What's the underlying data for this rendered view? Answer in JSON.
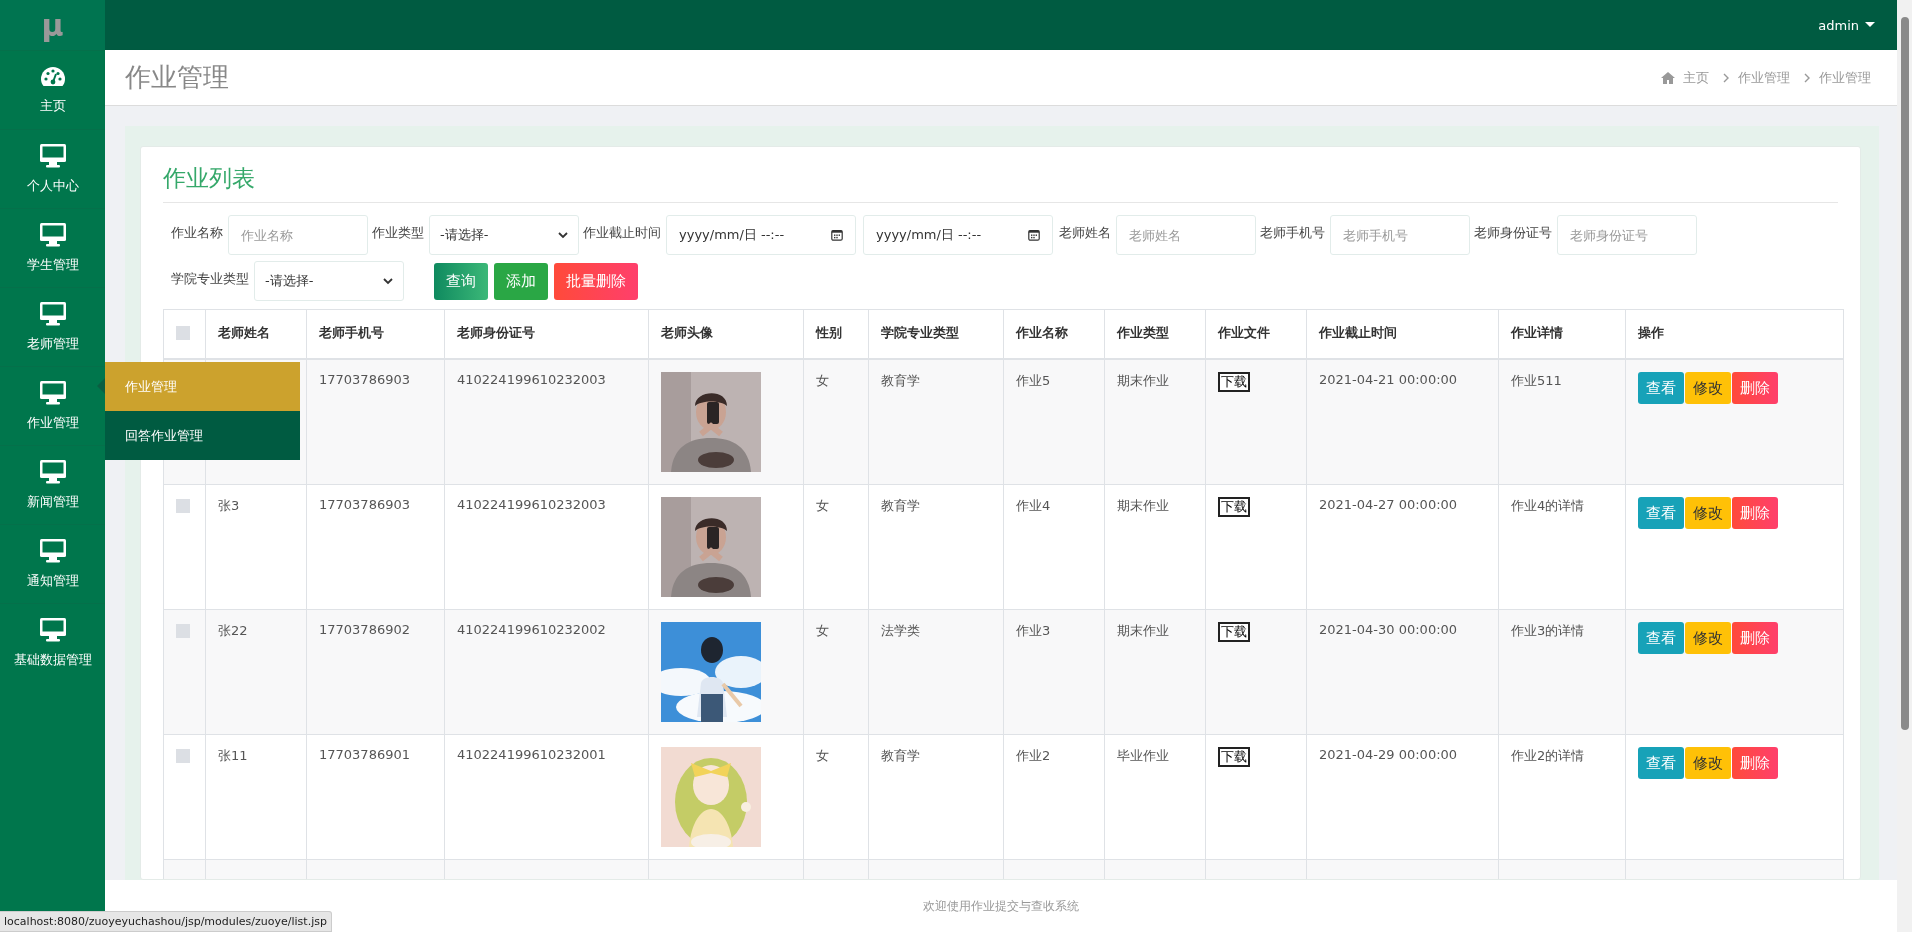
{
  "logo": "μ",
  "user_menu": {
    "label": "admin"
  },
  "sidebar": {
    "items": [
      {
        "label": "主页"
      },
      {
        "label": "个人中心"
      },
      {
        "label": "学生管理"
      },
      {
        "label": "老师管理"
      },
      {
        "label": "作业管理"
      },
      {
        "label": "新闻管理"
      },
      {
        "label": "通知管理"
      },
      {
        "label": "基础数据管理"
      }
    ]
  },
  "submenu": {
    "items": [
      {
        "label": "作业管理",
        "selected": true
      },
      {
        "label": "回答作业管理",
        "selected": false
      }
    ]
  },
  "page_title": "作业管理",
  "breadcrumb": [
    "主页",
    "作业管理",
    "作业管理"
  ],
  "card_title": "作业列表",
  "filter_rows": [
    [
      {
        "kind": "text",
        "label": "作业名称",
        "placeholder": "作业名称"
      },
      {
        "kind": "select",
        "label": "作业类型",
        "value": "-请选择-"
      },
      {
        "kind": "date_range",
        "label": "作业截止时间",
        "fields": [
          {
            "placeholder": "yyyy/mm/日 --:--"
          },
          {
            "placeholder": "yyyy/mm/日 --:--"
          }
        ]
      },
      {
        "kind": "text",
        "label": "老师姓名",
        "placeholder": "老师姓名"
      },
      {
        "kind": "text",
        "label": "老师手机号",
        "placeholder": "老师手机号"
      },
      {
        "kind": "text",
        "label": "老师身份证号",
        "placeholder": "老师身份证号"
      }
    ],
    [
      {
        "kind": "select",
        "label": "学院专业类型",
        "value": "-请选择-"
      },
      {
        "kind": "buttons",
        "buttons": [
          {
            "kind": "query",
            "label": "查询"
          },
          {
            "kind": "add",
            "label": "添加"
          },
          {
            "kind": "batch_delete",
            "label": "批量删除"
          }
        ]
      }
    ]
  ],
  "table": {
    "select_all": {
      "checked": false
    },
    "columns": [
      "老师姓名",
      "老师手机号",
      "老师身份证号",
      "老师头像",
      "性别",
      "学院专业类型",
      "作业名称",
      "作业类型",
      "作业文件",
      "作业截止时间",
      "作业详情",
      "操作"
    ],
    "rows": [
      {
        "phone": "17703786903",
        "id_number": "410224199610232003",
        "avatar": {
          "kind": "picture"
        },
        "sex": "女",
        "major": "教育学",
        "homework_name": "作业5",
        "homework_type": "期末作业",
        "file_button": "下载",
        "deadline": "2021-04-21 00:00:00",
        "detail": "作业511",
        "operations": [
          {
            "kind": "view",
            "label": "查看"
          },
          {
            "kind": "edit",
            "label": "修改"
          },
          {
            "kind": "delete",
            "label": "删除"
          }
        ]
      },
      {
        "checked": false,
        "name": "张3",
        "phone": "17703786903",
        "id_number": "410224199610232003",
        "avatar": {
          "kind": "picture"
        },
        "sex": "女",
        "major": "教育学",
        "homework_name": "作业4",
        "homework_type": "期末作业",
        "file_button": "下载",
        "deadline": "2021-04-27 00:00:00",
        "detail": "作业4的详情",
        "operations": [
          {
            "kind": "view",
            "label": "查看"
          },
          {
            "kind": "edit",
            "label": "修改"
          },
          {
            "kind": "delete",
            "label": "删除"
          }
        ]
      },
      {
        "checked": false,
        "name": "张22",
        "phone": "17703786902",
        "id_number": "410224199610232002",
        "avatar": {
          "kind": "picture"
        },
        "sex": "女",
        "major": "法学类",
        "homework_name": "作业3",
        "homework_type": "期末作业",
        "file_button": "下载",
        "deadline": "2021-04-30 00:00:00",
        "detail": "作业3的详情",
        "operations": [
          {
            "kind": "view",
            "label": "查看"
          },
          {
            "kind": "edit",
            "label": "修改"
          },
          {
            "kind": "delete",
            "label": "删除"
          }
        ]
      },
      {
        "checked": false,
        "name": "张11",
        "phone": "17703786901",
        "id_number": "410224199610232001",
        "avatar": {
          "kind": "picture"
        },
        "sex": "女",
        "major": "教育学",
        "homework_name": "作业2",
        "homework_type": "毕业作业",
        "file_button": "下载",
        "deadline": "2021-04-29 00:00:00",
        "detail": "作业2的详情",
        "operations": [
          {
            "kind": "view",
            "label": "查看"
          },
          {
            "kind": "edit",
            "label": "修改"
          },
          {
            "kind": "delete",
            "label": "删除"
          }
        ]
      }
    ]
  },
  "footer": "欢迎使用作业提交与查收系统",
  "status_url": "localhost:8080/zuoyeyuchashou/jsp/modules/zuoye/list.jsp"
}
